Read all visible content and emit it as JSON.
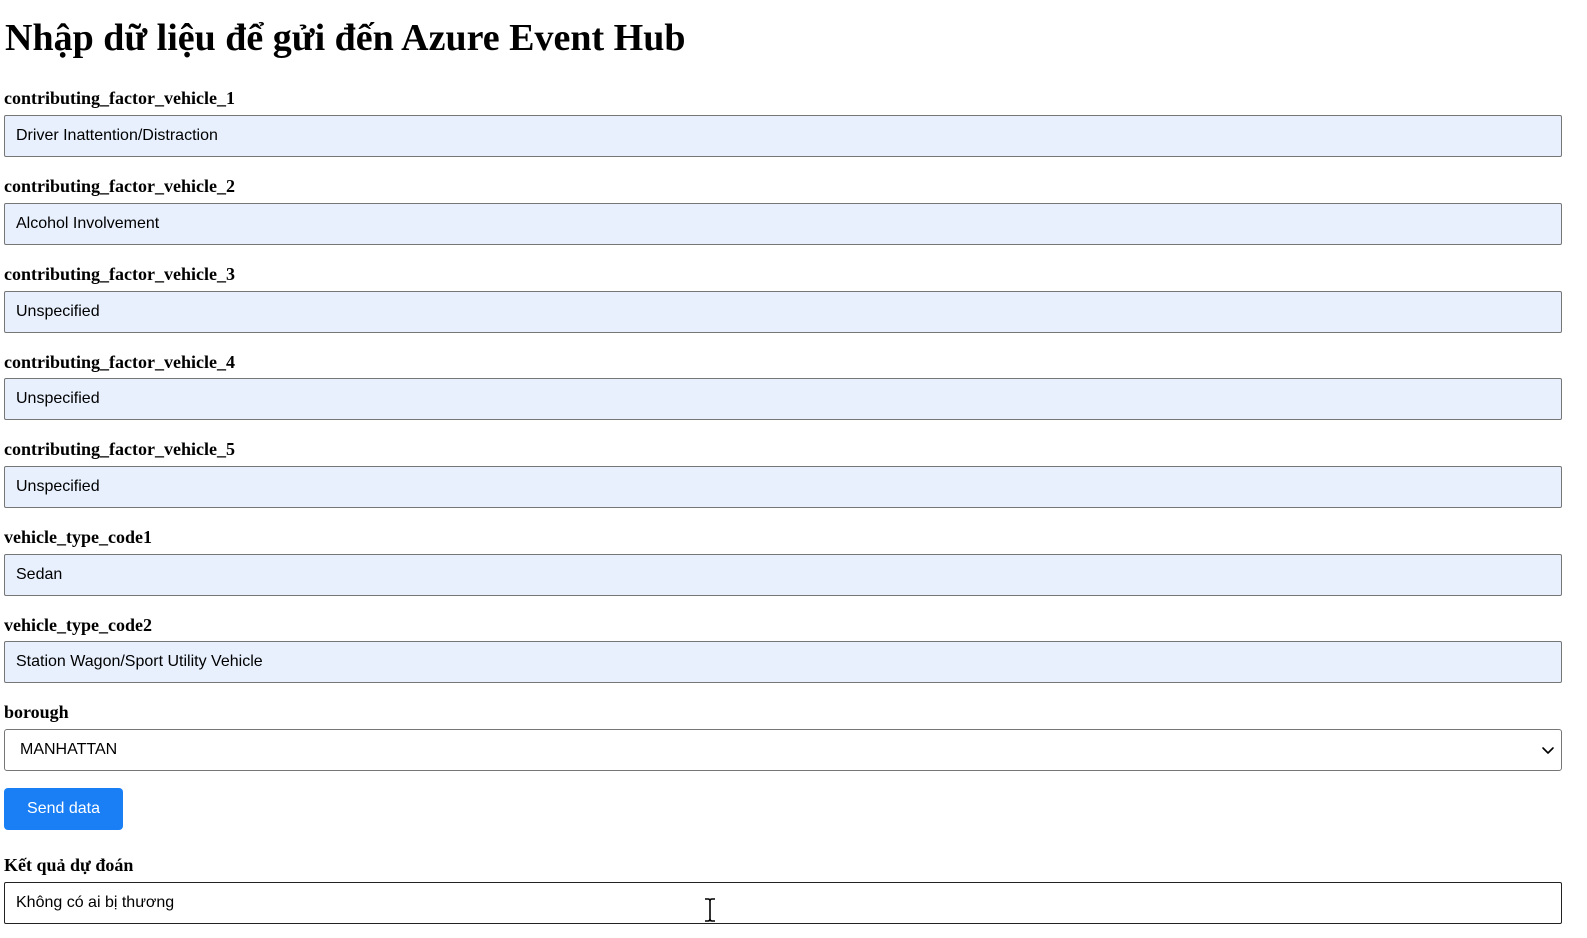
{
  "page": {
    "title": "Nhập dữ liệu để gửi đến Azure Event Hub"
  },
  "fields": [
    {
      "label": "contributing_factor_vehicle_1",
      "value": "Driver Inattention/Distraction"
    },
    {
      "label": "contributing_factor_vehicle_2",
      "value": "Alcohol Involvement"
    },
    {
      "label": "contributing_factor_vehicle_3",
      "value": "Unspecified"
    },
    {
      "label": "contributing_factor_vehicle_4",
      "value": "Unspecified"
    },
    {
      "label": "contributing_factor_vehicle_5",
      "value": "Unspecified"
    },
    {
      "label": "vehicle_type_code1",
      "value": "Sedan"
    },
    {
      "label": "vehicle_type_code2",
      "value": "Station Wagon/Sport Utility Vehicle"
    }
  ],
  "borough": {
    "label": "borough",
    "selected": "MANHATTAN"
  },
  "actions": {
    "send_label": "Send data"
  },
  "result": {
    "label": "Kết quả dự đoán",
    "value": "Không có ai bị thương"
  },
  "colors": {
    "autofill_background": "#e8f0fe",
    "button_background": "#1a7ff5",
    "button_text": "#ffffff"
  },
  "icons": {
    "select_indicator": "chevron-down-icon",
    "mouse_cursor": "text-cursor-icon"
  }
}
